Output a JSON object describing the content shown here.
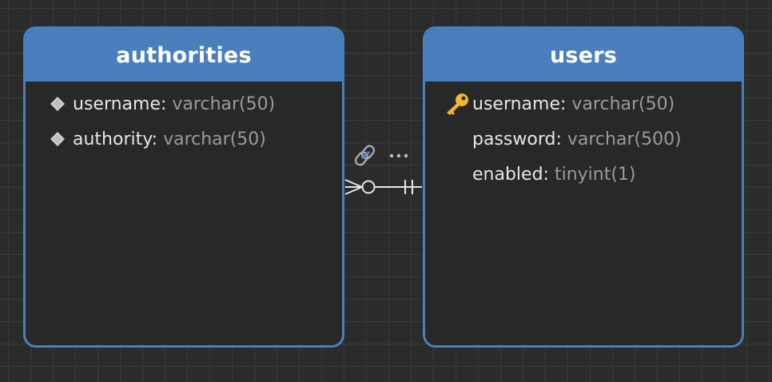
{
  "tables": [
    {
      "name": "authorities",
      "columns": [
        {
          "name": "username",
          "type": "varchar(50)",
          "icon": "diamond-icon"
        },
        {
          "name": "authority",
          "type": "varchar(50)",
          "icon": "diamond-icon"
        }
      ]
    },
    {
      "name": "users",
      "columns": [
        {
          "name": "username",
          "type": "varchar(50)",
          "icon": "primary-key-icon"
        },
        {
          "name": "password",
          "type": "varchar(500)",
          "icon": ""
        },
        {
          "name": "enabled",
          "type": "tinyint(1)",
          "icon": ""
        }
      ]
    }
  ],
  "relationship": {
    "from": "authorities",
    "to": "users",
    "from_cardinality": "zero-or-many",
    "to_cardinality": "exactly-one",
    "icons": [
      "link-icon",
      "ellipsis-icon"
    ]
  },
  "colors": {
    "header": "#4a7fbd",
    "body": "#282828",
    "canvas": "#2b2b2b",
    "key": "#f2b630",
    "diamond": "#cfcfcf",
    "type_text": "#9a9a9a"
  }
}
